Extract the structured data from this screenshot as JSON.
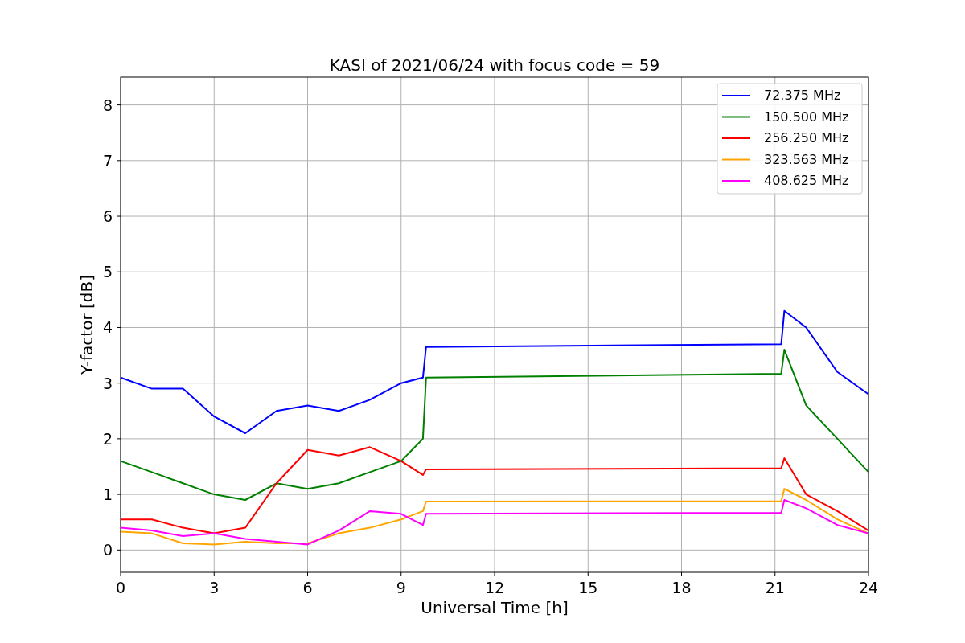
{
  "chart_data": {
    "type": "line",
    "title": "KASI of 2021/06/24 with focus code = 59",
    "xlabel": "Universal Time [h]",
    "ylabel": "Y-factor [dB]",
    "x": [
      0,
      1,
      2,
      3,
      4,
      5,
      6,
      7,
      8,
      9,
      9.7,
      9.8,
      21.2,
      21.3,
      22,
      23,
      24
    ],
    "series": [
      {
        "name": "72.375 MHz",
        "color": "#0000ff",
        "values": [
          3.1,
          2.9,
          2.9,
          2.4,
          2.1,
          2.5,
          2.6,
          2.5,
          2.7,
          3.0,
          3.1,
          3.65,
          3.7,
          4.3,
          4.0,
          3.2,
          2.8
        ]
      },
      {
        "name": "150.500 MHz",
        "color": "#008000",
        "values": [
          1.6,
          1.4,
          1.2,
          1.0,
          0.9,
          1.2,
          1.1,
          1.2,
          1.4,
          1.6,
          2.0,
          3.1,
          3.17,
          3.6,
          2.6,
          2.0,
          1.4
        ]
      },
      {
        "name": "256.250 MHz",
        "color": "#ff0000",
        "values": [
          0.55,
          0.55,
          0.4,
          0.3,
          0.4,
          1.2,
          1.8,
          1.7,
          1.85,
          1.6,
          1.35,
          1.45,
          1.47,
          1.65,
          1.0,
          0.7,
          0.35
        ]
      },
      {
        "name": "323.563 MHz",
        "color": "#ffa500",
        "values": [
          0.33,
          0.3,
          0.12,
          0.1,
          0.15,
          0.12,
          0.12,
          0.3,
          0.4,
          0.55,
          0.7,
          0.87,
          0.88,
          1.1,
          0.9,
          0.55,
          0.3
        ]
      },
      {
        "name": "408.625 MHz",
        "color": "#ff00ff",
        "values": [
          0.4,
          0.35,
          0.25,
          0.3,
          0.2,
          0.15,
          0.1,
          0.35,
          0.7,
          0.65,
          0.45,
          0.65,
          0.67,
          0.9,
          0.75,
          0.45,
          0.3
        ]
      }
    ],
    "grid": true,
    "legend": true,
    "xlim": [
      0,
      24
    ],
    "ylim": [
      -0.4,
      8.5
    ],
    "xticks": [
      0,
      3,
      6,
      9,
      12,
      15,
      18,
      21,
      24
    ],
    "yticks": [
      0,
      1,
      2,
      3,
      4,
      5,
      6,
      7,
      8
    ]
  }
}
